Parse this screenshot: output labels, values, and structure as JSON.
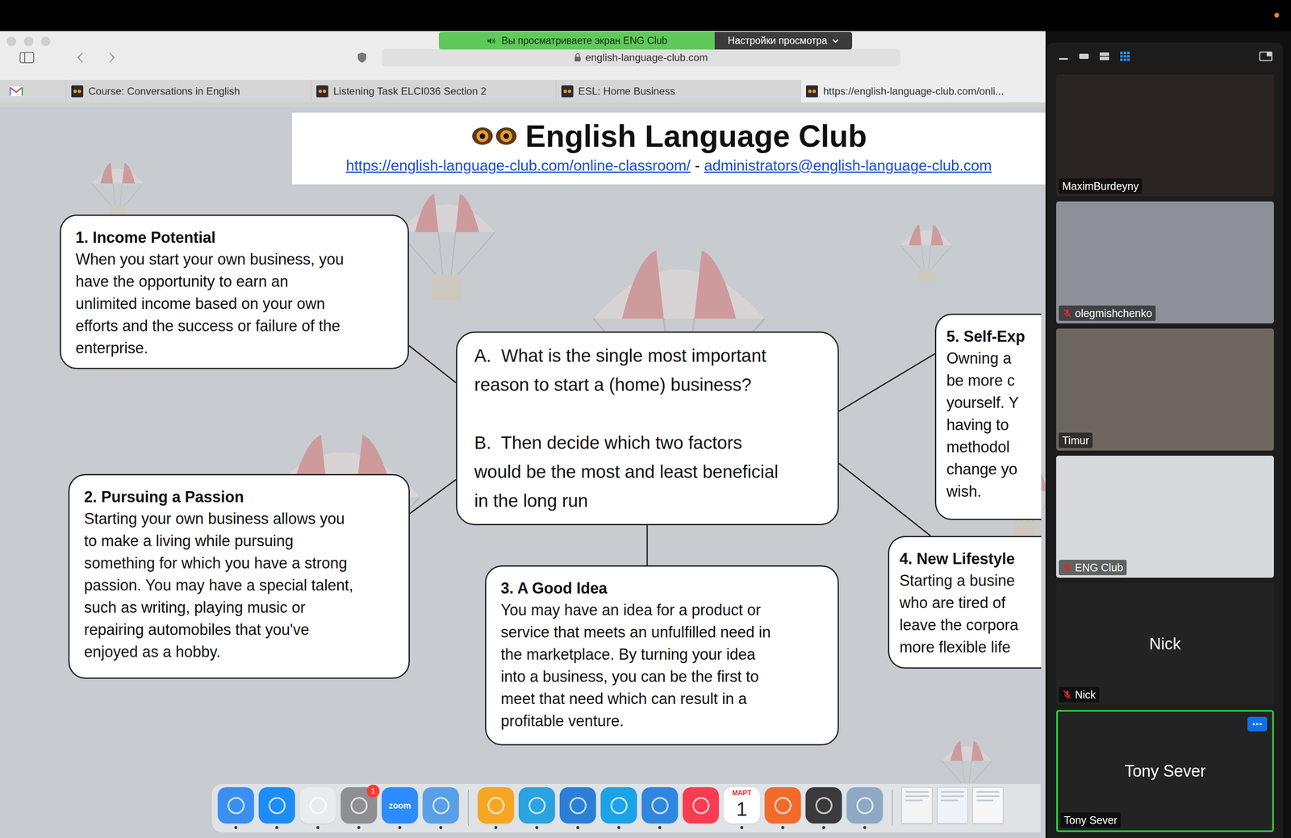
{
  "banner": {
    "text": "Вы просматриваете экран ENG Club",
    "settings": "Настройки просмотра"
  },
  "browser": {
    "address": "english-language-club.com",
    "tabs": [
      {
        "label": "Course: Conversations in English",
        "selected": false
      },
      {
        "label": "Listening Task ELCI036 Section 2",
        "selected": false
      },
      {
        "label": "ESL: Home Business",
        "selected": false
      },
      {
        "label": "https://english-language-club.com/onli...",
        "selected": true
      }
    ]
  },
  "slide": {
    "title": "English Language Club",
    "link": "https://english-language-club.com/online-classroom/",
    "separator": "-",
    "email": "administrators@english-language-club.com",
    "question": [
      [
        "A.  What is the single most important",
        "reason to start a (home) business?"
      ],
      [
        "B.  Then decide which two factors",
        "would be the most and least beneficial",
        "in the long run"
      ]
    ],
    "factors": [
      {
        "title": "1. Income Potential",
        "lines": [
          "When you start your own business, you",
          "have the opportunity to earn an",
          "unlimited income based on your own",
          "efforts and the success or failure of the",
          "enterprise."
        ]
      },
      {
        "title": "2. Pursuing a Passion",
        "lines": [
          "Starting your own business allows you",
          "to make a living while pursuing",
          "something for which you have a strong",
          "passion. You may have a special talent,",
          "such as writing, playing music or",
          "repairing automobiles that you've",
          "enjoyed as a hobby."
        ]
      },
      {
        "title": "3. A Good Idea",
        "lines": [
          "You may have an idea for a product or",
          "service that meets an unfulfilled need in",
          "the marketplace. By turning your idea",
          "into a business, you can be the first to",
          "meet that need which can result in a",
          "profitable venture."
        ]
      },
      {
        "title": "4. New Lifestyle",
        "lines": [
          "Starting a busine",
          "who are tired of",
          "leave the corpora",
          "more flexible life"
        ]
      },
      {
        "title": "5. Self-Exp",
        "lines": [
          "Owning a",
          "be more c",
          "yourself. Y",
          "having to",
          "methodol",
          "change yo",
          "wish."
        ]
      }
    ]
  },
  "dock": {
    "items": [
      {
        "kind": "app",
        "color": "#3b8ff0",
        "running": true
      },
      {
        "kind": "app",
        "color": "#1d8cf5",
        "running": true
      },
      {
        "kind": "app",
        "color": "#e9ecef",
        "running": true
      },
      {
        "kind": "app",
        "color": "#8e8e93",
        "running": true,
        "badge": "1"
      },
      {
        "kind": "app",
        "color": "#2d8cff",
        "running": true,
        "label": "zoom"
      },
      {
        "kind": "app",
        "color": "#5aa0e6",
        "running": true
      },
      {
        "kind": "separator"
      },
      {
        "kind": "app",
        "color": "#f5a623",
        "running": true
      },
      {
        "kind": "app",
        "color": "#2aa3e0",
        "running": true
      },
      {
        "kind": "app",
        "color": "#2b7fd6",
        "running": true
      },
      {
        "kind": "app",
        "color": "#1aa3e8",
        "running": true
      },
      {
        "kind": "app",
        "color": "#2e86de",
        "running": true
      },
      {
        "kind": "app",
        "color": "#fa3c52",
        "running": false
      },
      {
        "kind": "calendar",
        "month": "МАРТ",
        "day": "1",
        "running": true
      },
      {
        "kind": "app",
        "color": "#f26b2b",
        "running": true
      },
      {
        "kind": "app",
        "color": "#3a3a3c",
        "running": true
      },
      {
        "kind": "app",
        "color": "#8fa9c4",
        "running": true
      },
      {
        "kind": "separator"
      },
      {
        "kind": "document",
        "color": "#f4f4f4",
        "running": false
      },
      {
        "kind": "document",
        "color": "#eef3fb",
        "running": false
      },
      {
        "kind": "document",
        "color": "#f7f7f7",
        "running": false
      }
    ]
  },
  "gallery": {
    "views": [
      {
        "selected": false
      },
      {
        "selected": false
      },
      {
        "selected": true
      }
    ],
    "participants": [
      {
        "name": "MaximBurdeyny",
        "video": true,
        "muted": false,
        "speaking": false,
        "color": "#2a2523"
      },
      {
        "name": "olegmishchenko",
        "video": true,
        "muted": true,
        "speaking": false,
        "color": "#8d9096"
      },
      {
        "name": "Timur",
        "video": true,
        "muted": false,
        "speaking": false,
        "color": "#6d665f"
      },
      {
        "name": "ENG Club",
        "video": true,
        "muted": true,
        "speaking": false,
        "color": "#d8d9da"
      },
      {
        "name": "Nick",
        "video": false,
        "muted": true,
        "speaking": false
      },
      {
        "name": "Tony Sever",
        "video": false,
        "muted": false,
        "speaking": true
      }
    ]
  }
}
